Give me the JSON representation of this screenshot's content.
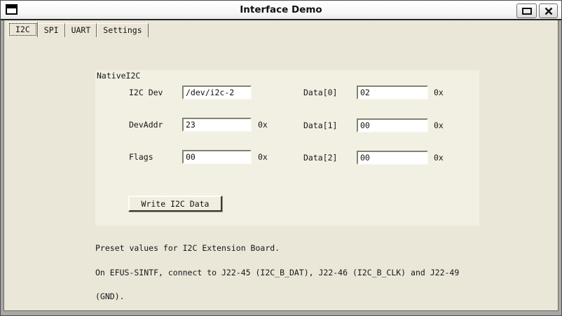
{
  "window": {
    "title": "Interface Demo",
    "controls": {
      "menu_icon": "window-glyph",
      "maximize_icon": "square-outline",
      "close_icon": "x-mark"
    }
  },
  "tabs": [
    {
      "label": "I2C",
      "active": true
    },
    {
      "label": "SPI",
      "active": false
    },
    {
      "label": "UART",
      "active": false
    },
    {
      "label": "Settings",
      "active": false
    }
  ],
  "panel": {
    "title": "NativeI2C",
    "fields_left": [
      {
        "label": "I2C Dev",
        "value": "/dev/i2c-2",
        "suffix": ""
      },
      {
        "label": "DevAddr",
        "value": "23",
        "suffix": "0x"
      },
      {
        "label": "Flags",
        "value": "00",
        "suffix": "0x"
      }
    ],
    "fields_right": [
      {
        "label": "Data[0]",
        "value": "02",
        "suffix": "0x"
      },
      {
        "label": "Data[1]",
        "value": "00",
        "suffix": "0x"
      },
      {
        "label": "Data[2]",
        "value": "00",
        "suffix": "0x"
      }
    ],
    "button_label": "Write I2C Data"
  },
  "note_lines": [
    "Preset values for I2C Extension Board.",
    "On EFUS-SINTF, connect to J22-45 (I2C_B_DAT), J22-46 (I2C_B_CLK) and J22-49",
    "(GND)."
  ],
  "colors": {
    "content_bg": "#eae7d9",
    "panel_bg": "#f2f0e3",
    "titlebar_bg": "#ffffff",
    "frame_gray": "#a8a8a8",
    "entry_bg": "#ffffff",
    "text": "#161616"
  }
}
